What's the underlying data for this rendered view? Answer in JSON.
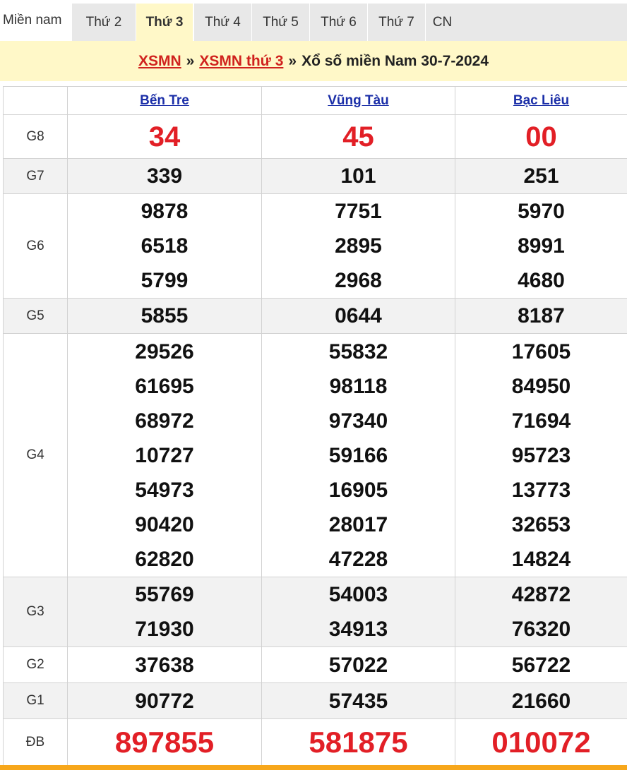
{
  "tabs": [
    {
      "label": "Miền nam"
    },
    {
      "label": "Thứ 2"
    },
    {
      "label": "Thứ 3"
    },
    {
      "label": "Thứ 4"
    },
    {
      "label": "Thứ 5"
    },
    {
      "label": "Thứ 6"
    },
    {
      "label": "Thứ 7"
    },
    {
      "label": "CN"
    }
  ],
  "active_tab": "Thứ 3",
  "heading": {
    "link1": "XSMN",
    "sep1": "»",
    "link2": "XSMN thứ 3",
    "sep2": "»",
    "title": "Xổ số miền Nam 30-7-2024"
  },
  "provinces": [
    "Bến Tre",
    "Vũng Tàu",
    "Bạc Liêu"
  ],
  "prizes": [
    {
      "label": "G8",
      "values": [
        [
          "34"
        ],
        [
          "45"
        ],
        [
          "00"
        ]
      ]
    },
    {
      "label": "G7",
      "values": [
        [
          "339"
        ],
        [
          "101"
        ],
        [
          "251"
        ]
      ]
    },
    {
      "label": "G6",
      "values": [
        [
          "9878",
          "6518",
          "5799"
        ],
        [
          "7751",
          "2895",
          "2968"
        ],
        [
          "5970",
          "8991",
          "4680"
        ]
      ]
    },
    {
      "label": "G5",
      "values": [
        [
          "5855"
        ],
        [
          "0644"
        ],
        [
          "8187"
        ]
      ]
    },
    {
      "label": "G4",
      "values": [
        [
          "29526",
          "61695",
          "68972",
          "10727",
          "54973",
          "90420",
          "62820"
        ],
        [
          "55832",
          "98118",
          "97340",
          "59166",
          "16905",
          "28017",
          "47228"
        ],
        [
          "17605",
          "84950",
          "71694",
          "95723",
          "13773",
          "32653",
          "14824"
        ]
      ]
    },
    {
      "label": "G3",
      "values": [
        [
          "55769",
          "71930"
        ],
        [
          "54003",
          "34913"
        ],
        [
          "42872",
          "76320"
        ]
      ]
    },
    {
      "label": "G2",
      "values": [
        [
          "37638"
        ],
        [
          "57022"
        ],
        [
          "56722"
        ]
      ]
    },
    {
      "label": "G1",
      "values": [
        [
          "90772"
        ],
        [
          "57435"
        ],
        [
          "21660"
        ]
      ]
    },
    {
      "label": "ĐB",
      "values": [
        [
          "897855"
        ],
        [
          "581875"
        ],
        [
          "010072"
        ]
      ]
    }
  ],
  "colors": {
    "highlight_number": "#e21f26",
    "link_red": "#d0221e",
    "link_blue": "#1c2fa8",
    "heading_bg": "#fff8c8",
    "bottom_bar": "#f7a71b"
  }
}
